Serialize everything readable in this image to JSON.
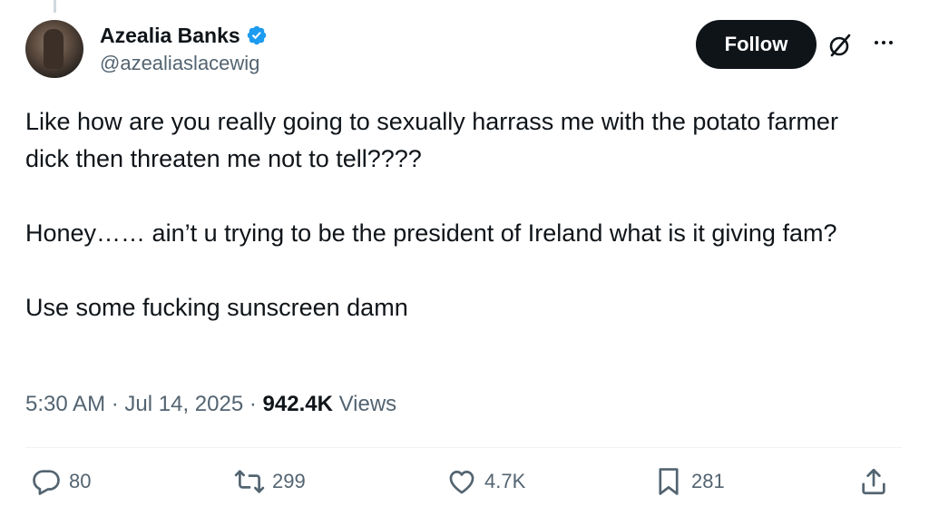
{
  "tweet": {
    "author": {
      "display_name": "Azealia Banks",
      "handle": "@azealiaslacewig",
      "verified": true,
      "avatar_icon": "profile-photo"
    },
    "follow_label": "Follow",
    "icons": {
      "grok": "grok-icon",
      "more": "more-icon"
    },
    "paragraphs": [
      "Like how are you really going to sexually harrass me with the potato farmer dick then threaten me not to tell????",
      "Honey…… ain’t u trying to be the president of Ireland what is it giving fam?",
      "Use some fucking sunscreen damn"
    ],
    "time": "5:30 AM",
    "date": "Jul 14, 2025",
    "separator": "·",
    "views_count": "942.4K",
    "views_label": "Views",
    "actions": {
      "replies": "80",
      "reposts": "299",
      "likes": "4.7K",
      "bookmarks": "281"
    },
    "colors": {
      "text": "#0f1419",
      "secondary": "#536471",
      "verified": "#1d9bf0",
      "follow_bg": "#0f1419"
    }
  }
}
